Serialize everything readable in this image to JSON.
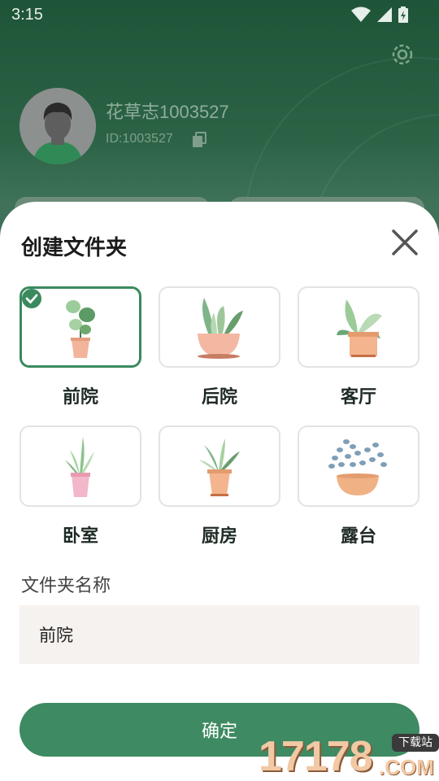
{
  "status_bar": {
    "time": "3:15"
  },
  "profile": {
    "username": "花草志1003527",
    "user_id": "ID:1003527"
  },
  "dialog": {
    "title": "创建文件夹",
    "folders": [
      {
        "label": "前院",
        "selected": true
      },
      {
        "label": "后院",
        "selected": false
      },
      {
        "label": "客厅",
        "selected": false
      },
      {
        "label": "卧室",
        "selected": false
      },
      {
        "label": "厨房",
        "selected": false
      },
      {
        "label": "露台",
        "selected": false
      }
    ],
    "name_label": "文件夹名称",
    "name_value": "前院",
    "confirm_label": "确定"
  },
  "watermark": {
    "number": "17178",
    "suffix": ".COM",
    "badge": "下载站"
  },
  "colors": {
    "accent": "#3e8a62",
    "header_bg": "#2c6346",
    "input_bg": "#f6f2ef"
  }
}
